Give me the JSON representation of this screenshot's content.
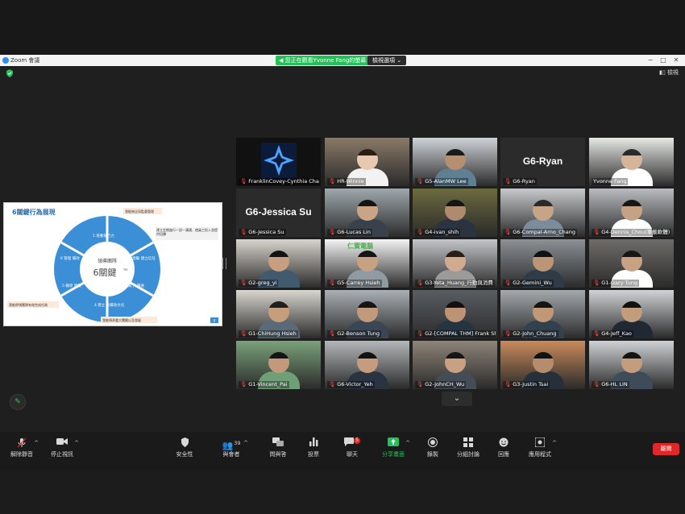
{
  "window": {
    "app_title": "Zoom 會議",
    "viewing_banner": "您正在觀看Yvonne Fang的螢幕",
    "view_options": "檢視選項",
    "view_button": "檢視"
  },
  "share": {
    "title": "6關鍵行為展現",
    "center_top": "領導團隊",
    "center_main": "6關鍵",
    "tm": "TM",
    "notes": [
      "我能夠全局監督管理",
      "建立定期進行一對一溝通、使員工投入並提供回饋",
      "我能帶領團隊有效完成任務",
      "我能傳承重大關鍵以及發展"
    ],
    "segments": [
      "1 培養執行力",
      "2 激勵 建立信任",
      "3 賦予 溝通",
      "4 建立 高績效文化",
      "5 輔導 發展",
      "6 管理 績效"
    ],
    "page_num": "6"
  },
  "participants": [
    {
      "name": "FranklinCovey-Cynthia Chang",
      "muted": true,
      "kind": "logo"
    },
    {
      "name": "HR-Winnie",
      "muted": true,
      "kind": "video",
      "bg": "#8a7a66",
      "skin": "#e8c9b0",
      "shirt": "#f2f2f2",
      "hair": "#2a1d16"
    },
    {
      "name": "G5-AlanMW Lee",
      "muted": true,
      "kind": "video",
      "bg": "#cfd3d7",
      "skin": "#b78e70",
      "shirt": "#5f7f93",
      "hair": "#1a1a1a"
    },
    {
      "name": "G6-Ryan",
      "muted": true,
      "kind": "name",
      "big": "G6-Ryan"
    },
    {
      "name": "Yvonne Fang",
      "muted": false,
      "kind": "video",
      "active": true,
      "bg": "#e6e8e4",
      "skin": "#d6b49a",
      "shirt": "#ffffff",
      "hair": "#2b2b2b"
    },
    {
      "name": "G6-Jessica Su",
      "muted": true,
      "kind": "name",
      "big": "G6-Jessica Su"
    },
    {
      "name": "G6-Lucas Lin",
      "muted": true,
      "kind": "video",
      "bg": "#9fa8ad",
      "skin": "#c9a585",
      "shirt": "#39424a",
      "hair": "#141414"
    },
    {
      "name": "G4-ivan_shih",
      "muted": true,
      "kind": "video",
      "bg": "#6b6a3e",
      "skin": "#b08a6c",
      "shirt": "#2b3340",
      "hair": "#151515"
    },
    {
      "name": "G6-Compal-Arno_Chang",
      "muted": true,
      "kind": "video",
      "bg": "#c7c9cc",
      "skin": "#c8a487",
      "shirt": "#7b8c9a",
      "hair": "#2a2a2a"
    },
    {
      "name": "G4-Dennis_Chou(車載軟體)",
      "muted": true,
      "kind": "video",
      "bg": "#b9bcc0",
      "skin": "#c5a283",
      "shirt": "#ffffff",
      "hair": "#181818"
    },
    {
      "name": "G2-greg_yi",
      "muted": true,
      "kind": "video",
      "bg": "#d8d4cd",
      "skin": "#c79f80",
      "shirt": "#415a6e",
      "hair": "#121212"
    },
    {
      "name": "G5-Carrey Hsieh",
      "muted": true,
      "kind": "video",
      "bg": "#f4f4f4",
      "skin": "#c7a182",
      "shirt": "#8f9aa3",
      "hair": "#151515",
      "banner": "仁寶電腦"
    },
    {
      "name": "G3-Yeta_Huang_行動與消費",
      "muted": true,
      "kind": "video",
      "bg": "#c3c5c8",
      "skin": "#d0ab90",
      "shirt": "#9b9b9b",
      "hair": "#2a1d16"
    },
    {
      "name": "G2-Gemini_Wu",
      "muted": true,
      "kind": "video",
      "bg": "#8c9196",
      "skin": "#bc9577",
      "shirt": "#2f3b46",
      "hair": "#111111"
    },
    {
      "name": "G1-Gary Tung",
      "muted": true,
      "kind": "video",
      "bg": "#6d6c68",
      "skin": "#c9a183",
      "shirt": "#ffffff",
      "hair": "#161616"
    },
    {
      "name": "G1-ChiHung Hsieh",
      "muted": true,
      "kind": "video",
      "bg": "#d9d6cf",
      "skin": "#c69e7c",
      "shirt": "#5a6a78",
      "hair": "#1e1e1e"
    },
    {
      "name": "G2-Benson Tung",
      "muted": true,
      "kind": "video",
      "bg": "#aab0b5",
      "skin": "#c29a7a",
      "shirt": "#3a4654",
      "hair": "#151515"
    },
    {
      "name": "G2-[COMPAL THM] Frank Sh...",
      "muted": true,
      "kind": "video",
      "bg": "#595e63",
      "skin": "#bd9473",
      "shirt": "#263340",
      "hair": "#111111"
    },
    {
      "name": "G2-John_Chuang",
      "muted": true,
      "kind": "video",
      "bg": "#a4a9ad",
      "skin": "#c09878",
      "shirt": "#33414e",
      "hair": "#141414"
    },
    {
      "name": "G4-Jeff_Kao",
      "muted": true,
      "kind": "video",
      "bg": "#d0d3d6",
      "skin": "#c39c7c",
      "shirt": "#1f2833",
      "hair": "#111111"
    },
    {
      "name": "G1-Vincent_Pai",
      "muted": true,
      "kind": "video",
      "bg": "#7aa27a",
      "skin": "#c29a7b",
      "shirt": "#6f9f76",
      "hair": "#151515"
    },
    {
      "name": "G6-Victor_Yeh",
      "muted": true,
      "kind": "video",
      "bg": "#b4b7ba",
      "skin": "#c59d7e",
      "shirt": "#2a3440",
      "hair": "#121212"
    },
    {
      "name": "G2-JohnCH_Wu",
      "muted": true,
      "kind": "video",
      "bg": "#8e8478",
      "skin": "#c8a182",
      "shirt": "#444c55",
      "hair": "#161616"
    },
    {
      "name": "G3-Justin Tsai",
      "muted": true,
      "kind": "video",
      "bg": "#c98a5a",
      "skin": "#b58d6c",
      "shirt": "#26303a",
      "hair": "#121212"
    },
    {
      "name": "G6-HL LIN",
      "muted": true,
      "kind": "video",
      "bg": "#cfd2d5",
      "skin": "#c49d7e",
      "shirt": "#3e4b58",
      "hair": "#141414"
    }
  ],
  "toolbar": {
    "unmute": "解除靜音",
    "stop_video": "停止視訊",
    "security": "安全性",
    "participants": "與會者",
    "participants_count": "39",
    "qa": "問與答",
    "polls": "投票",
    "chat": "聊天",
    "chat_badge": "5",
    "share_screen": "分享畫面",
    "record": "錄製",
    "breakout": "分組討論",
    "reactions": "回應",
    "apps": "應用程式",
    "end": "離開"
  },
  "colors": {
    "accent_green": "#23c157",
    "end_red": "#e02828",
    "active_border": "#c9f26b",
    "share_blue": "#3a8fd6"
  }
}
